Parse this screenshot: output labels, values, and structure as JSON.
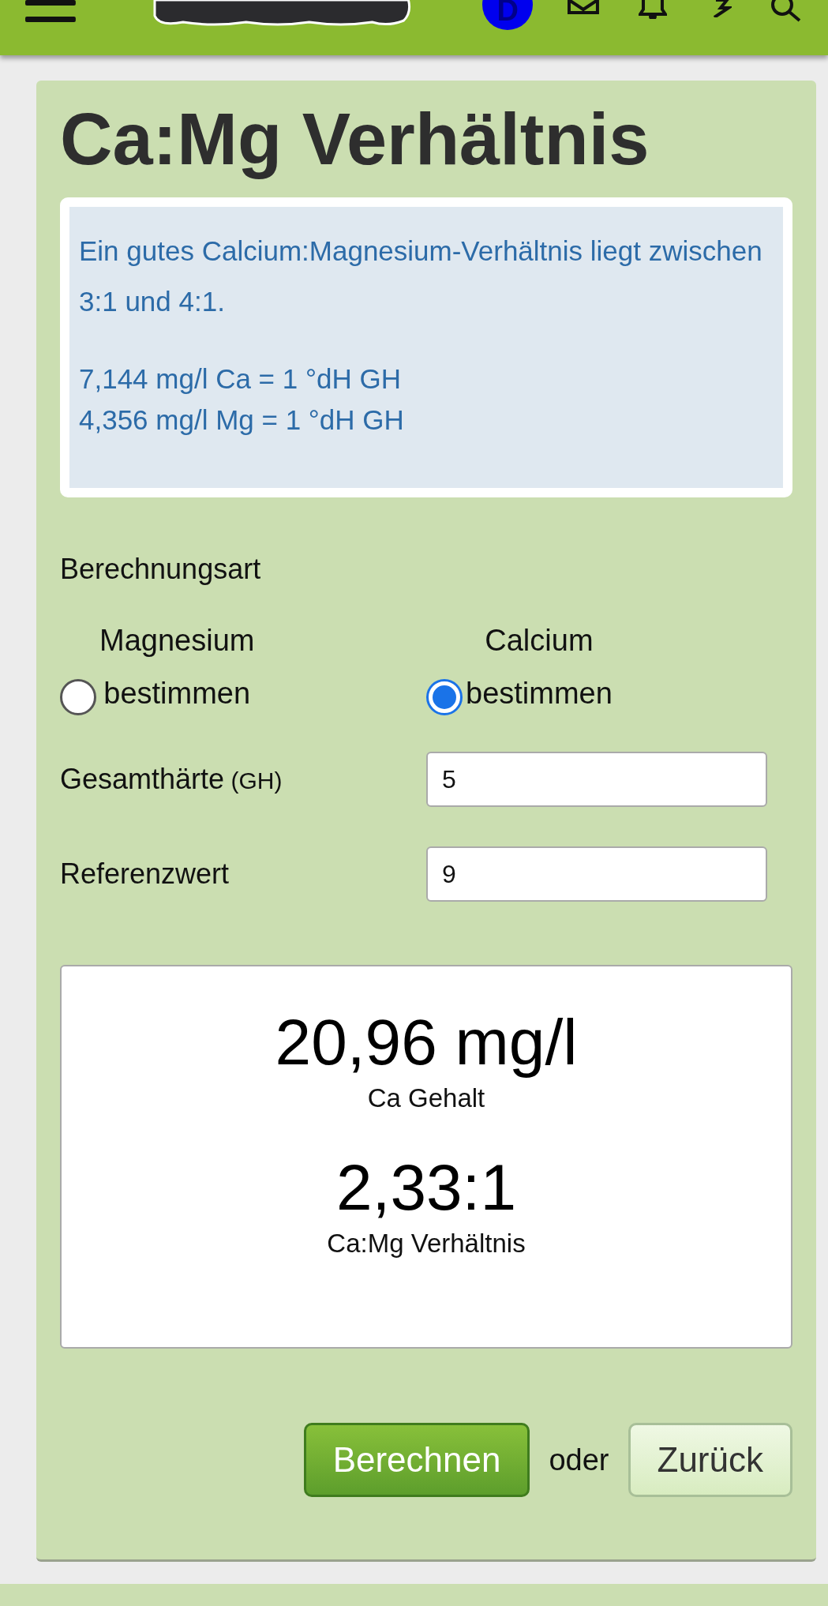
{
  "header": {
    "avatar_letter": "D"
  },
  "title": "Ca:Mg Verhältnis",
  "info": {
    "lines": [
      "Ein gutes Calcium:Magnesium-Verhältnis liegt zwischen 3:1 und 4:1."
    ],
    "formulas": [
      "7,144 mg/l Ca = 1 °dH GH",
      "4,356 mg/l Mg = 1 °dH GH"
    ]
  },
  "mode": {
    "label": "Berechnungsart",
    "options": [
      {
        "top": "Magnesium",
        "bottom": "bestimmen",
        "selected": false
      },
      {
        "top": "Calcium",
        "bottom": "bestimmen",
        "selected": true
      }
    ]
  },
  "fields": [
    {
      "label": "Gesamthärte",
      "suffix": "(GH)",
      "value": "5"
    },
    {
      "label": "Referenzwert",
      "value": "9"
    }
  ],
  "results": [
    {
      "value": "20,96 mg/l",
      "caption": "Ca Gehalt"
    },
    {
      "value": "2,33:1",
      "caption": "Ca:Mg Verhältnis"
    }
  ],
  "actions": {
    "primary": "Berechnen",
    "separator": "oder",
    "secondary": "Zurück"
  }
}
